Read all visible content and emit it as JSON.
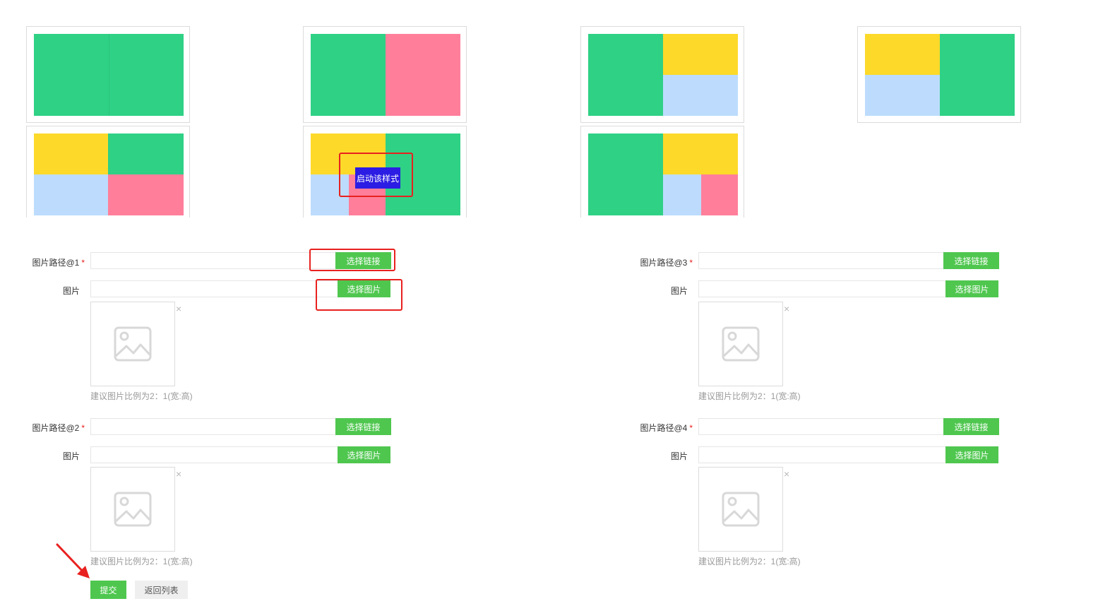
{
  "layouts": {
    "enable_label": "启动该样式"
  },
  "colors": {
    "green": "#2fd185",
    "pink": "#ff7f9b",
    "yellow": "#fdd92a",
    "blue": "#bddcfd",
    "button_green": "#4fc74f",
    "enable_blue": "#2b1de3",
    "highlight_red": "#e8211f"
  },
  "form": {
    "path1_label": "图片路径@1",
    "path2_label": "图片路径@2",
    "path3_label": "图片路径@3",
    "path4_label": "图片路径@4",
    "required_mark": "*",
    "image_label": "图片",
    "select_link": "选择链接",
    "select_image": "选择图片",
    "close_glyph": "×",
    "hint": "建议图片比例为2：1(宽:高)",
    "placeholder_icon": "image-placeholder-icon",
    "submit": "提交",
    "back": "返回列表"
  },
  "annotation": {
    "arrow_icon": "red-arrow-icon"
  }
}
